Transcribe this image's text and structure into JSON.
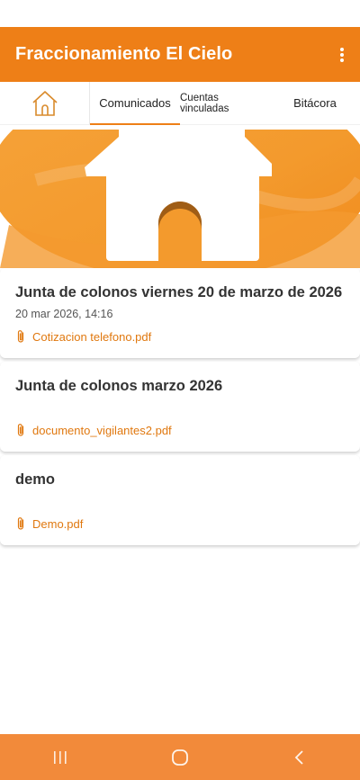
{
  "app": {
    "title": "Fraccionamiento El Cielo",
    "menu_icon": "more-vert-icon"
  },
  "tabs": [
    {
      "label": "",
      "icon": "home-icon",
      "active": false
    },
    {
      "label": "Comunicados",
      "active": true
    },
    {
      "label": "Cuentas vinculadas",
      "active": false
    },
    {
      "label": "Bitácora",
      "active": false
    }
  ],
  "colors": {
    "primary": "#ee7f17",
    "accent_text": "#e0780f",
    "nav_bar": "#f28a3a"
  },
  "posts": [
    {
      "title": "Junta de colonos viernes 20 de marzo de 2026",
      "date": "20 mar 2026, 14:16",
      "attachment": "Cotizacion telefono.pdf"
    },
    {
      "title": "Junta de colonos marzo 2026",
      "date": "",
      "attachment": "documento_vigilantes2.pdf"
    },
    {
      "title": "demo",
      "date": "",
      "attachment": "Demo.pdf"
    }
  ],
  "system_nav": [
    "recent-apps-icon",
    "home-circle-icon",
    "back-icon"
  ]
}
